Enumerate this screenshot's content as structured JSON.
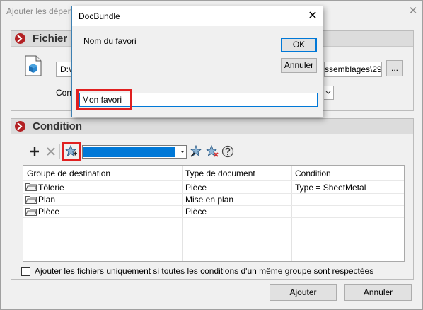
{
  "main_window": {
    "title": "Ajouter les dépend",
    "close_glyph": "✕"
  },
  "fichier": {
    "title": "Fichier",
    "path_start": "D:\\V",
    "path_end": "ssemblages\\29",
    "browse_label": "...",
    "config_label": "Confi"
  },
  "condition": {
    "title": "Condition",
    "toolbar": {
      "icons": [
        "add-icon",
        "delete-icon",
        "add-favorite-icon",
        "favorite-dropdown",
        "pin-favorite-icon",
        "remove-favorite-icon",
        "help-icon"
      ]
    },
    "favorite_select_value": "",
    "columns": [
      "Groupe de destination",
      "Type de document",
      "Condition"
    ],
    "rows": [
      [
        "Tôlerie",
        "Pièce",
        "Type = SheetMetal"
      ],
      [
        "Plan",
        "Mise en plan",
        ""
      ],
      [
        "Pièce",
        "Pièce",
        ""
      ]
    ],
    "checkbox_label": "Ajouter les fichiers uniquement si toutes les conditions d'un même groupe sont respectées",
    "checkbox_checked": false
  },
  "buttons": {
    "add": "Ajouter",
    "cancel": "Annuler"
  },
  "dialog": {
    "title": "DocBundle",
    "close_glyph": "✕",
    "prompt": "Nom du favori",
    "ok_label": "OK",
    "cancel_label": "Annuler",
    "input_value": "Mon favori"
  },
  "colors": {
    "accent": "#0078d7",
    "highlight_red": "#e02020",
    "section_arrow": "#b32124"
  }
}
